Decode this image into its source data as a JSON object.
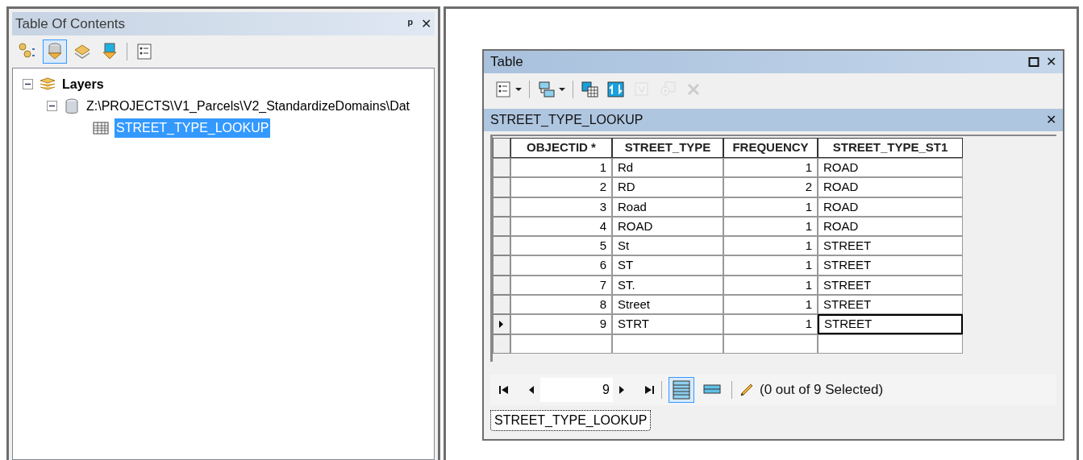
{
  "toc": {
    "title": "Table Of Contents",
    "pin": "ᵖ",
    "close": "✕",
    "toolbar": [
      {
        "kind": "source",
        "selected": false
      },
      {
        "kind": "drawing",
        "selected": true
      },
      {
        "kind": "visibility",
        "selected": false
      },
      {
        "kind": "selection",
        "selected": false
      },
      {
        "kind": "options",
        "selected": false
      }
    ],
    "tree": [
      {
        "label": "Layers",
        "kind": "frame",
        "expanded": true,
        "children": [
          {
            "label": "Z:\\PROJECTS\\V1_Parcels\\V2_StandardizeDomains\\Dat",
            "kind": "database",
            "expanded": true,
            "children": [
              {
                "label": "STREET_TYPE_LOOKUP",
                "kind": "table",
                "selected": true
              }
            ]
          }
        ]
      }
    ]
  },
  "table_window": {
    "title": "Table",
    "close": "✕",
    "toolbar": [
      {
        "kind": "options",
        "disabled": false,
        "dropdown": true
      },
      {
        "kind": "related",
        "disabled": false,
        "dropdown": true
      },
      {
        "kind": "select-by",
        "disabled": false,
        "dropdown": false
      },
      {
        "kind": "switch",
        "disabled": false,
        "dropdown": false
      },
      {
        "kind": "clear",
        "disabled": true,
        "dropdown": false
      },
      {
        "kind": "zoom",
        "disabled": true,
        "dropdown": false
      },
      {
        "kind": "delete",
        "disabled": true,
        "dropdown": false
      }
    ],
    "table_name": "STREET_TYPE_LOOKUP",
    "table_close": "✕",
    "columns": [
      "OBJECTID *",
      "STREET_TYPE",
      "FREQUENCY",
      "STREET_TYPE_ST1"
    ],
    "rows": [
      {
        "cells": [
          "1",
          "Rd",
          "1",
          "ROAD"
        ],
        "current": false
      },
      {
        "cells": [
          "2",
          "RD",
          "2",
          "ROAD"
        ],
        "current": false
      },
      {
        "cells": [
          "3",
          "Road",
          "1",
          "ROAD"
        ],
        "current": false
      },
      {
        "cells": [
          "4",
          "ROAD",
          "1",
          "ROAD"
        ],
        "current": false
      },
      {
        "cells": [
          "5",
          "St",
          "1",
          "STREET"
        ],
        "current": false
      },
      {
        "cells": [
          "6",
          "ST",
          "1",
          "STREET"
        ],
        "current": false
      },
      {
        "cells": [
          "7",
          "ST.",
          "1",
          "STREET"
        ],
        "current": false
      },
      {
        "cells": [
          "8",
          "Street",
          "1",
          "STREET"
        ],
        "current": false
      },
      {
        "cells": [
          "9",
          "STRT",
          "1",
          "STREET"
        ],
        "current": true
      }
    ],
    "record_field": "9",
    "views": [
      {
        "kind": "all",
        "selected": true
      },
      {
        "kind": "selected",
        "selected": false
      }
    ],
    "selection_status": "(0 out of 9 Selected)",
    "tabs": [
      {
        "label": "STREET_TYPE_LOOKUP",
        "selected": true
      }
    ]
  }
}
